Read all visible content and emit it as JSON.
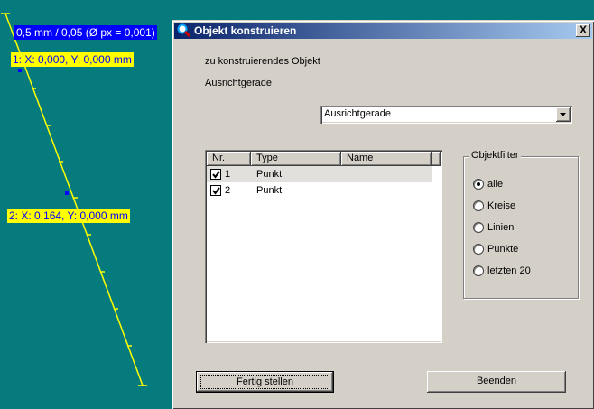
{
  "canvas": {
    "scale_label": "0,5 mm / 0,05 (Ø px = 0,001)",
    "point1_label": "1: X: 0,000, Y: 0,000 mm",
    "point2_label": "2: X: 0,164, Y: 0,000 mm",
    "line_color": "#ffff00",
    "background_color": "#067b7d"
  },
  "dialog": {
    "title": "Objekt konstruieren",
    "close_symbol": "X",
    "object_caption": "zu konstruierendes Objekt",
    "object_name": "Ausrichtgerade",
    "combo_value": "Ausrichtgerade",
    "list": {
      "columns": [
        "Nr.",
        "Type",
        "Name"
      ],
      "rows": [
        {
          "nr": "1",
          "type": "Punkt",
          "name": "",
          "checked": true
        },
        {
          "nr": "2",
          "type": "Punkt",
          "name": "",
          "checked": true
        }
      ]
    },
    "filter": {
      "title": "Objektfilter",
      "options": [
        "alle",
        "Kreise",
        "Linien",
        "Punkte",
        "letzten 20"
      ],
      "selected": "alle"
    },
    "finish_label": "Fertig stellen",
    "quit_label": "Beenden"
  }
}
